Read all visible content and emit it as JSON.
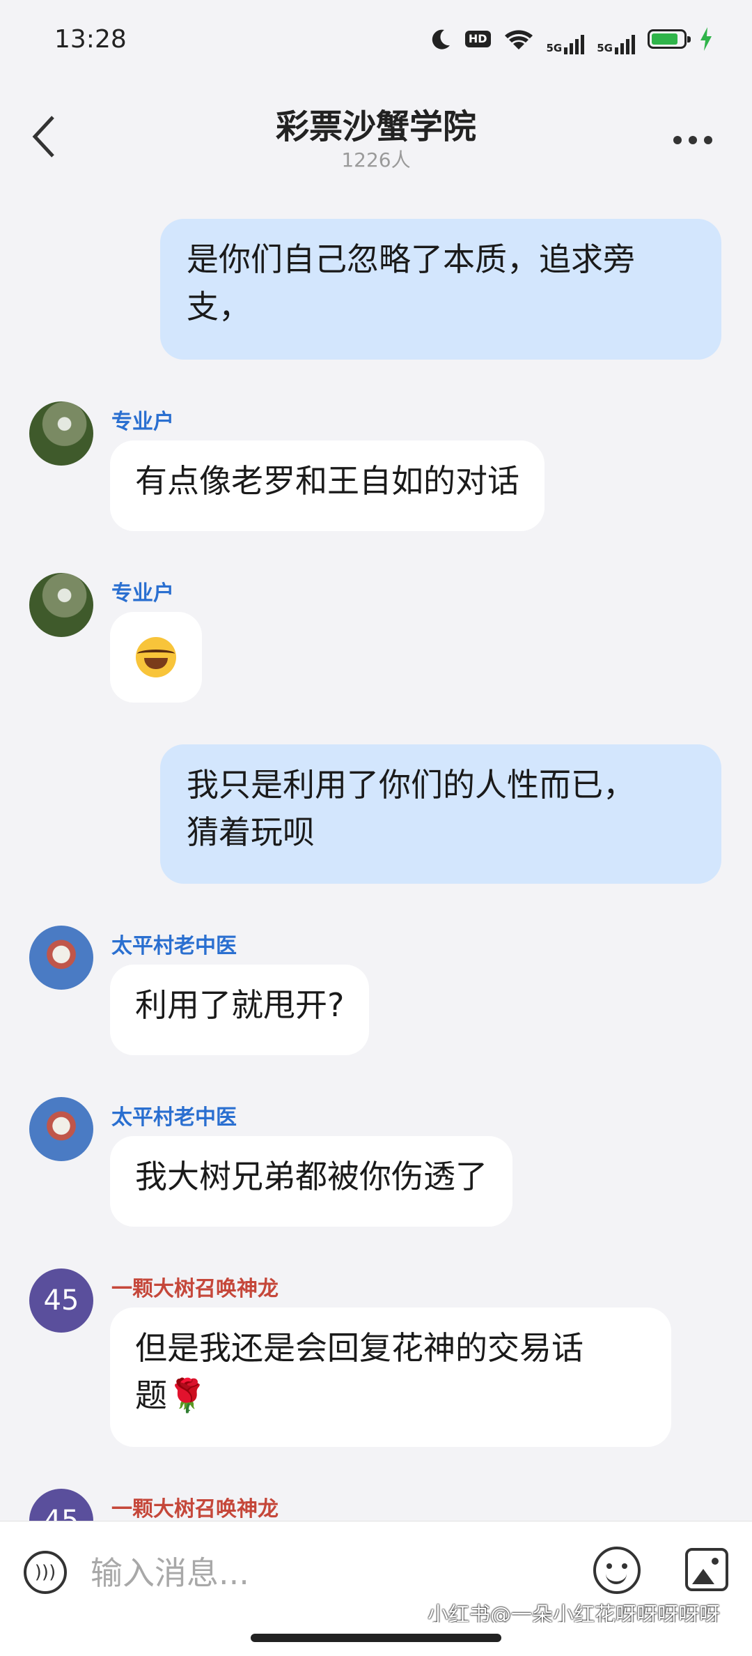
{
  "status_bar": {
    "time": "13:28",
    "hd_label": "HD",
    "net1": "5G",
    "net2": "5G",
    "battery_level": 0.85
  },
  "header": {
    "title": "彩票沙蟹学院",
    "member_count": "1226人"
  },
  "messages": [
    {
      "side": "out",
      "text": "是你们自己忽略了本质，追求旁\n支，"
    },
    {
      "side": "in",
      "sender": "专业户",
      "avatar": "photo-avatar",
      "text": "有点像老罗和王自如的对话"
    },
    {
      "side": "in",
      "sender": "专业户",
      "avatar": "photo-avatar",
      "emoji": "laughing-tears-emoji"
    },
    {
      "side": "out",
      "text": "我只是利用了你们的人性而已，\n猜着玩呗"
    },
    {
      "side": "in",
      "sender": "太平村老中医",
      "avatar": "rabbit-avatar",
      "text": "利用了就甩开?"
    },
    {
      "side": "in",
      "sender": "太平村老中医",
      "avatar": "rabbit-avatar",
      "text": "我大树兄弟都被你伤透了"
    },
    {
      "side": "in",
      "sender": "一颗大树召唤神龙",
      "avatar_text": "45",
      "text": "但是我还是会回复花神的交易话\n题",
      "emoji": "rose-emoji"
    },
    {
      "side": "in",
      "sender": "一颗大树召唤神龙",
      "avatar_text": "45"
    }
  ],
  "input_bar": {
    "placeholder": "输入消息..."
  },
  "watermark": "小红书@一朵小红花呀呀呀呀呀",
  "colors": {
    "out_bubble": "#d3e6fd",
    "in_bubble": "#ffffff",
    "sender_blue": "#2a6fd0",
    "sender_red": "#c5473a",
    "avatar_45": "#5a4f9c"
  }
}
